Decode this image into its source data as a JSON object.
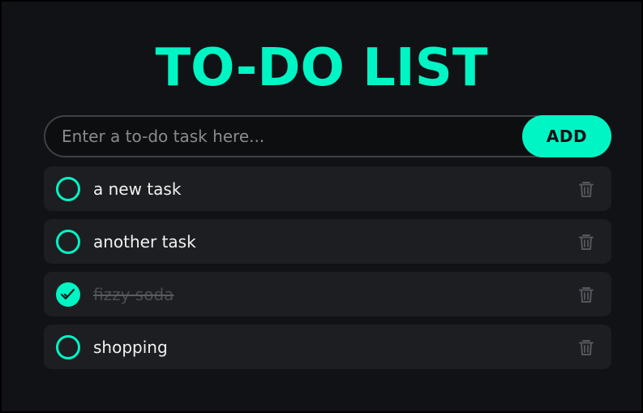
{
  "colors": {
    "accent": "#00f5c4",
    "item_bg": "#1d1e22",
    "page_bg": "#111215",
    "trash": "#55575c"
  },
  "header": {
    "title": "TO-DO LIST"
  },
  "input": {
    "placeholder": "Enter a to-do task here...",
    "value": "",
    "add_label": "ADD"
  },
  "tasks": [
    {
      "text": "a new task",
      "done": false,
      "icon": "circle-unchecked-icon",
      "delete_icon": "trash-icon"
    },
    {
      "text": "another task",
      "done": false,
      "icon": "circle-unchecked-icon",
      "delete_icon": "trash-icon"
    },
    {
      "text": "fizzy soda",
      "done": true,
      "icon": "circle-checked-icon",
      "delete_icon": "trash-icon"
    },
    {
      "text": "shopping",
      "done": false,
      "icon": "circle-unchecked-icon",
      "delete_icon": "trash-icon"
    }
  ]
}
